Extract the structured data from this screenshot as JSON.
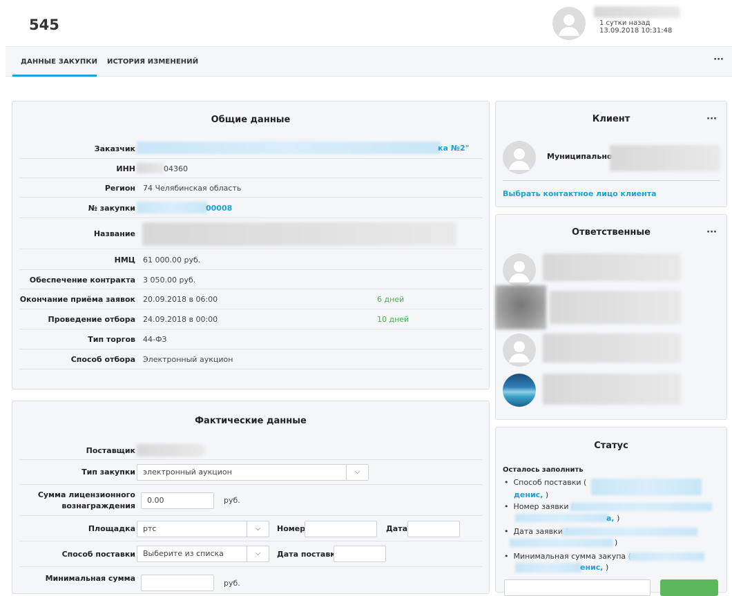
{
  "header": {
    "title": "545",
    "time_ago": "1 сутки назад",
    "datetime": "13.09.2018 10:31:48"
  },
  "tabs": [
    {
      "label": "ДАННЫЕ ЗАКУПКИ",
      "active": true
    },
    {
      "label": "ИСТОРИЯ ИЗМЕНЕНИЙ",
      "active": false
    }
  ],
  "more_label": "···",
  "general": {
    "title": "Общие данные",
    "rows": [
      {
        "label": "Заказчик",
        "value": "ка №2\""
      },
      {
        "label": "ИНН",
        "value": "04360"
      },
      {
        "label": "Регион",
        "value": "74 Челябинская область"
      },
      {
        "label": "№ закупки",
        "value": "00008"
      },
      {
        "label": "Название",
        "value": ""
      },
      {
        "label": "НМЦ",
        "value": "61 000.00 руб."
      },
      {
        "label": "Обеспечение контракта",
        "value": "3 050.00 руб."
      },
      {
        "label": "Окончание приёма заявок",
        "value": "20.09.2018 в 06:00",
        "extra": "6 дней"
      },
      {
        "label": "Проведение отбора",
        "value": "24.09.2018 в 00:00",
        "extra": "10 дней"
      },
      {
        "label": "Тип торгов",
        "value": "44-ФЗ"
      },
      {
        "label": "Способ отбора",
        "value": "Электронный аукцион"
      }
    ]
  },
  "actual": {
    "title": "Фактические данные",
    "supplier_label": "Поставщик",
    "purchase_type_label": "Тип закупки",
    "purchase_type_value": "электронный аукцион",
    "fee_label_1": "Сумма лицензионного",
    "fee_label_2": "вознаграждения",
    "fee_value": "0.00",
    "fee_unit": "руб.",
    "platform_label": "Площадка",
    "platform_value": "ртс",
    "number_label": "Номер",
    "date_label": "Дата",
    "delivery_method_label": "Способ поставки",
    "delivery_method_placeholder": "Выберите из списка",
    "delivery_date_label": "Дата поставки",
    "min_sum_label": "Минимальная сумма",
    "min_sum_unit": "руб."
  },
  "client": {
    "title": "Клиент",
    "name_prefix": "Муниципальное у",
    "contact_link": "Выбрать контактное лицо клиента"
  },
  "responsible": {
    "title": "Ответственные"
  },
  "status": {
    "title": "Статус",
    "remaining_label": "Осталось заполнить",
    "items": [
      {
        "text": "Способ поставки (",
        "link_tail": "денис,",
        "close": " )"
      },
      {
        "text": "Номер заявки (",
        "link_tail": "а,",
        "close": " )"
      },
      {
        "text": "Дата заявки (",
        "link_tail": "",
        "close": ")"
      },
      {
        "text": "Минимальная сумма закупа (",
        "link_tail": "енис,",
        "close": " )"
      }
    ]
  },
  "icons": {
    "dropdown": "chevron-down-icon",
    "avatar": "user-icon",
    "more": "more-icon"
  }
}
